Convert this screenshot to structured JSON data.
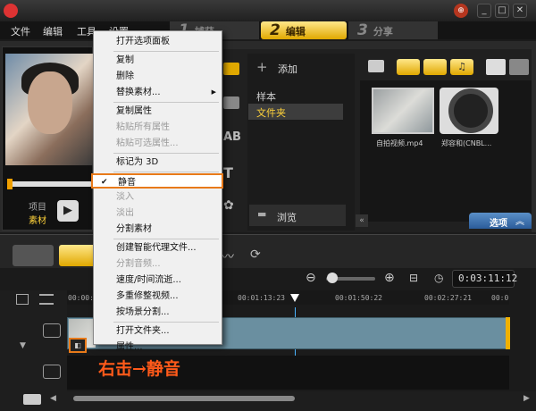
{
  "menubar": {
    "items": [
      "文件",
      "编辑",
      "工具",
      "设置"
    ]
  },
  "steps": [
    {
      "num": "1",
      "label": "捕获"
    },
    {
      "num": "2",
      "label": "编辑"
    },
    {
      "num": "3",
      "label": "分享"
    }
  ],
  "preview": {
    "item_label": "项目",
    "clip_label": "素材"
  },
  "context_menu": {
    "items": [
      {
        "label": "打开选项面板",
        "disabled": false
      },
      {
        "label": "复制",
        "disabled": false
      },
      {
        "label": "删除",
        "disabled": false
      },
      {
        "label": "替换素材...",
        "disabled": false,
        "submenu": true
      },
      {
        "label": "复制属性",
        "disabled": false
      },
      {
        "label": "粘贴所有属性",
        "disabled": true
      },
      {
        "label": "粘贴可选属性...",
        "disabled": true
      },
      {
        "label": "标记为 3D",
        "disabled": false
      },
      {
        "label": "静音",
        "disabled": false,
        "checked": true
      },
      {
        "label": "淡入",
        "disabled": true
      },
      {
        "label": "淡出",
        "disabled": true
      },
      {
        "label": "分割素材",
        "disabled": false
      },
      {
        "label": "创建智能代理文件...",
        "disabled": false
      },
      {
        "label": "分割音频...",
        "disabled": true
      },
      {
        "label": "速度/时间流逝...",
        "disabled": false
      },
      {
        "label": "多重修整视频...",
        "disabled": false
      },
      {
        "label": "按场景分割...",
        "disabled": false
      },
      {
        "label": "打开文件夹...",
        "disabled": false
      },
      {
        "label": "属性...",
        "disabled": false
      }
    ],
    "check_mark": "✔"
  },
  "library": {
    "add_label": "添加",
    "folders": [
      "样本",
      "文件夹"
    ],
    "browse_label": "浏览",
    "options_label": "选项",
    "thumbs": [
      {
        "label": "自拍视频.mp4"
      },
      {
        "label": "郑容和(CNBL..."
      }
    ]
  },
  "timeline": {
    "timecode": "0:03:11:12",
    "ticks": [
      "00:00:0",
      "00:01:13:23",
      "00:01:50:22",
      "00:02:27:21",
      "00:0"
    ]
  },
  "annotation": "右击→静音"
}
